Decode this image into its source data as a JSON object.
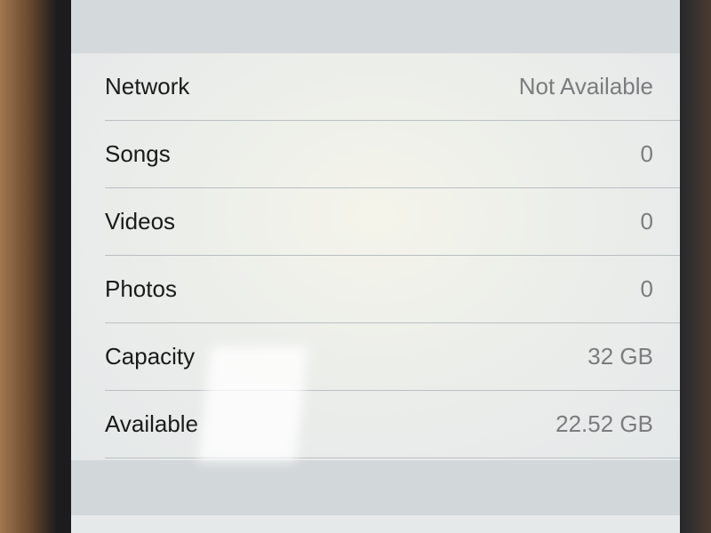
{
  "rows": [
    {
      "label": "Network",
      "value": "Not Available"
    },
    {
      "label": "Songs",
      "value": "0"
    },
    {
      "label": "Videos",
      "value": "0"
    },
    {
      "label": "Photos",
      "value": "0"
    },
    {
      "label": "Capacity",
      "value": "32 GB"
    },
    {
      "label": "Available",
      "value": "22.52 GB"
    }
  ]
}
